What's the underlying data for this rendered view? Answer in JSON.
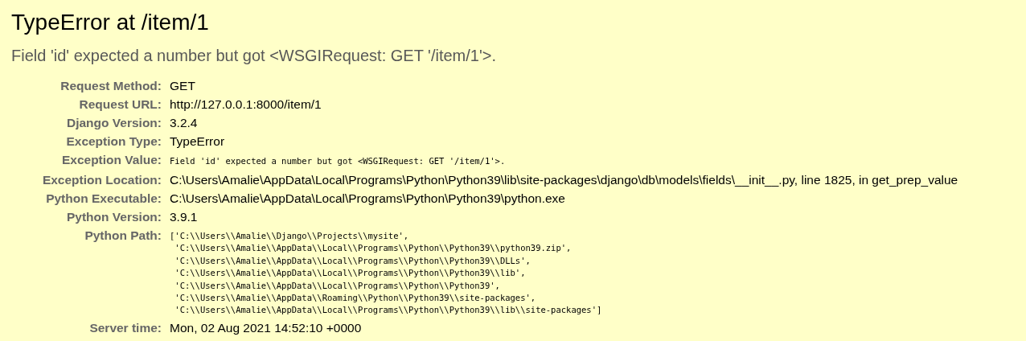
{
  "title": "TypeError at /item/1",
  "message": "Field 'id' expected a number but got <WSGIRequest: GET '/item/1'>.",
  "meta": [
    {
      "kind": "text",
      "label": "Request Method:",
      "value": "GET"
    },
    {
      "kind": "text",
      "label": "Request URL:",
      "value": "http://127.0.0.1:8000/item/1"
    },
    {
      "kind": "text",
      "label": "Django Version:",
      "value": "3.2.4"
    },
    {
      "kind": "text",
      "label": "Exception Type:",
      "value": "TypeError"
    },
    {
      "kind": "code",
      "label": "Exception Value:",
      "value": "Field 'id' expected a number but got <WSGIRequest: GET '/item/1'>."
    },
    {
      "kind": "text",
      "label": "Exception Location:",
      "value": "C:\\Users\\Amalie\\AppData\\Local\\Programs\\Python\\Python39\\lib\\site-packages\\django\\db\\models\\fields\\__init__.py, line 1825, in get_prep_value"
    },
    {
      "kind": "text",
      "label": "Python Executable:",
      "value": "C:\\Users\\Amalie\\AppData\\Local\\Programs\\Python\\Python39\\python.exe"
    },
    {
      "kind": "text",
      "label": "Python Version:",
      "value": "3.9.1"
    },
    {
      "kind": "lines",
      "label": "Python Path:",
      "lines": [
        "['C:\\\\Users\\\\Amalie\\\\Django\\\\Projects\\\\mysite',",
        " 'C:\\\\Users\\\\Amalie\\\\AppData\\\\Local\\\\Programs\\\\Python\\\\Python39\\\\python39.zip',",
        " 'C:\\\\Users\\\\Amalie\\\\AppData\\\\Local\\\\Programs\\\\Python\\\\Python39\\\\DLLs',",
        " 'C:\\\\Users\\\\Amalie\\\\AppData\\\\Local\\\\Programs\\\\Python\\\\Python39\\\\lib',",
        " 'C:\\\\Users\\\\Amalie\\\\AppData\\\\Local\\\\Programs\\\\Python\\\\Python39',",
        " 'C:\\\\Users\\\\Amalie\\\\AppData\\\\Roaming\\\\Python\\\\Python39\\\\site-packages',",
        " 'C:\\\\Users\\\\Amalie\\\\AppData\\\\Local\\\\Programs\\\\Python\\\\Python39\\\\lib\\\\site-packages']"
      ]
    },
    {
      "kind": "text",
      "label": "Server time:",
      "value": "Mon, 02 Aug 2021 14:52:10 +0000"
    }
  ]
}
